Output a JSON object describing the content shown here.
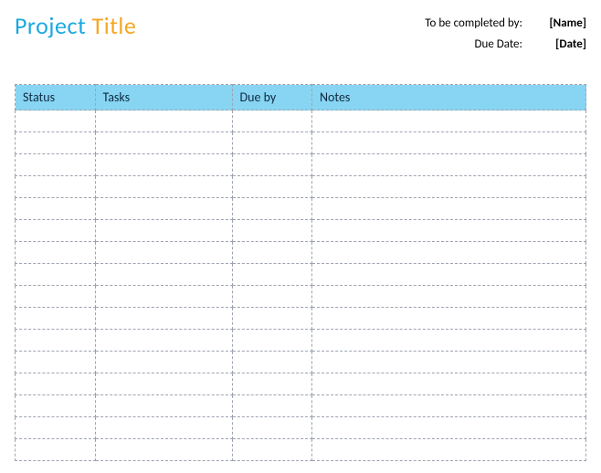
{
  "title": {
    "word1": "Project",
    "word2": "Title"
  },
  "meta": {
    "completed_by_label": "To be completed by:",
    "completed_by_value": "[Name]",
    "due_date_label": "Due Date:",
    "due_date_value": "[Date]"
  },
  "table": {
    "headers": {
      "status": "Status",
      "tasks": "Tasks",
      "dueby": "Due by",
      "notes": "Notes"
    },
    "rows": [
      {
        "status": "",
        "tasks": "",
        "dueby": "",
        "notes": ""
      },
      {
        "status": "",
        "tasks": "",
        "dueby": "",
        "notes": ""
      },
      {
        "status": "",
        "tasks": "",
        "dueby": "",
        "notes": ""
      },
      {
        "status": "",
        "tasks": "",
        "dueby": "",
        "notes": ""
      },
      {
        "status": "",
        "tasks": "",
        "dueby": "",
        "notes": ""
      },
      {
        "status": "",
        "tasks": "",
        "dueby": "",
        "notes": ""
      },
      {
        "status": "",
        "tasks": "",
        "dueby": "",
        "notes": ""
      },
      {
        "status": "",
        "tasks": "",
        "dueby": "",
        "notes": ""
      },
      {
        "status": "",
        "tasks": "",
        "dueby": "",
        "notes": ""
      },
      {
        "status": "",
        "tasks": "",
        "dueby": "",
        "notes": ""
      },
      {
        "status": "",
        "tasks": "",
        "dueby": "",
        "notes": ""
      },
      {
        "status": "",
        "tasks": "",
        "dueby": "",
        "notes": ""
      },
      {
        "status": "",
        "tasks": "",
        "dueby": "",
        "notes": ""
      },
      {
        "status": "",
        "tasks": "",
        "dueby": "",
        "notes": ""
      },
      {
        "status": "",
        "tasks": "",
        "dueby": "",
        "notes": ""
      },
      {
        "status": "",
        "tasks": "",
        "dueby": "",
        "notes": ""
      }
    ]
  }
}
